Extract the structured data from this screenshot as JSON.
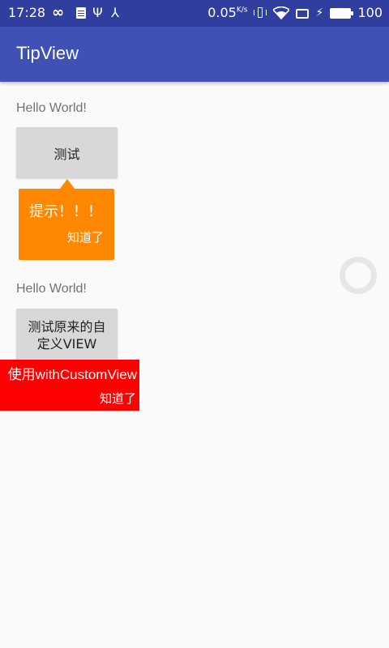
{
  "status_bar": {
    "time": "17:28",
    "net_speed": "0.05",
    "net_speed_unit": "K/s",
    "battery_level": "100",
    "icons": [
      "infinity-icon",
      "document-icon",
      "usb-icon",
      "share-icon",
      "vibrate-icon",
      "wifi-icon",
      "sim-icon",
      "charging-icon",
      "battery-icon"
    ]
  },
  "app_bar": {
    "title": "TipView"
  },
  "section1": {
    "hello": "Hello World!",
    "button": "测试",
    "tip": {
      "message": "提示！！！",
      "dismiss": "知道了",
      "color": "#ff8800"
    }
  },
  "section2": {
    "hello": "Hello World!",
    "button": "测试原来的自定义VIEW",
    "tip": {
      "message": "使用withCustomView",
      "dismiss": "知道了",
      "color": "#ff0000"
    }
  },
  "colors": {
    "status_bar": "#303f9f",
    "app_bar": "#3f51b5",
    "background": "#fafafa"
  }
}
